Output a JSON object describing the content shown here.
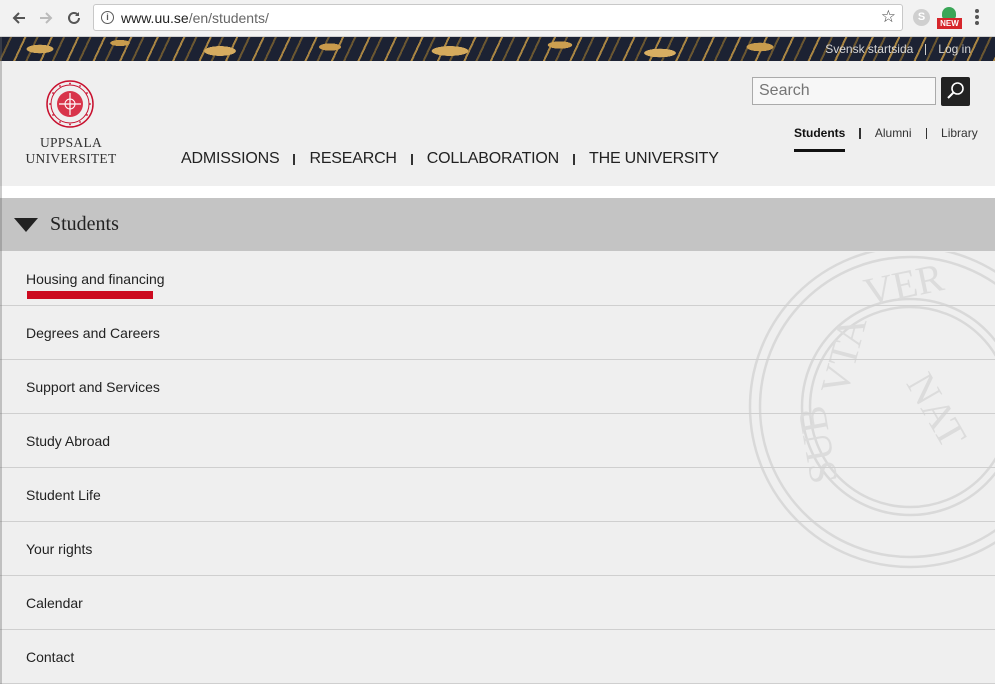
{
  "browser": {
    "url_host": "www.uu.se",
    "url_path": "/en/students/",
    "ext_badge": "NEW"
  },
  "toplinks": {
    "swedish": "Svensk startsida",
    "login": "Log in"
  },
  "logo": {
    "line1": "UPPSALA",
    "line2": "UNIVERSITET"
  },
  "search": {
    "placeholder": "Search"
  },
  "audience_nav": [
    {
      "label": "Students",
      "active": true
    },
    {
      "label": "Alumni",
      "active": false
    },
    {
      "label": "Library",
      "active": false
    }
  ],
  "main_nav": [
    {
      "label": "ADMISSIONS"
    },
    {
      "label": "RESEARCH"
    },
    {
      "label": "COLLABORATION"
    },
    {
      "label": "THE UNIVERSITY"
    }
  ],
  "section": {
    "title": "Students"
  },
  "menu_items": [
    {
      "label": "Housing and financing",
      "highlighted": true
    },
    {
      "label": "Degrees and Careers"
    },
    {
      "label": "Support and Services"
    },
    {
      "label": "Study Abroad"
    },
    {
      "label": "Student Life"
    },
    {
      "label": "Your rights"
    },
    {
      "label": "Calendar"
    },
    {
      "label": "Contact"
    }
  ],
  "colors": {
    "brand_red": "#cc0a1f",
    "section_gray": "#c4c4c4"
  }
}
